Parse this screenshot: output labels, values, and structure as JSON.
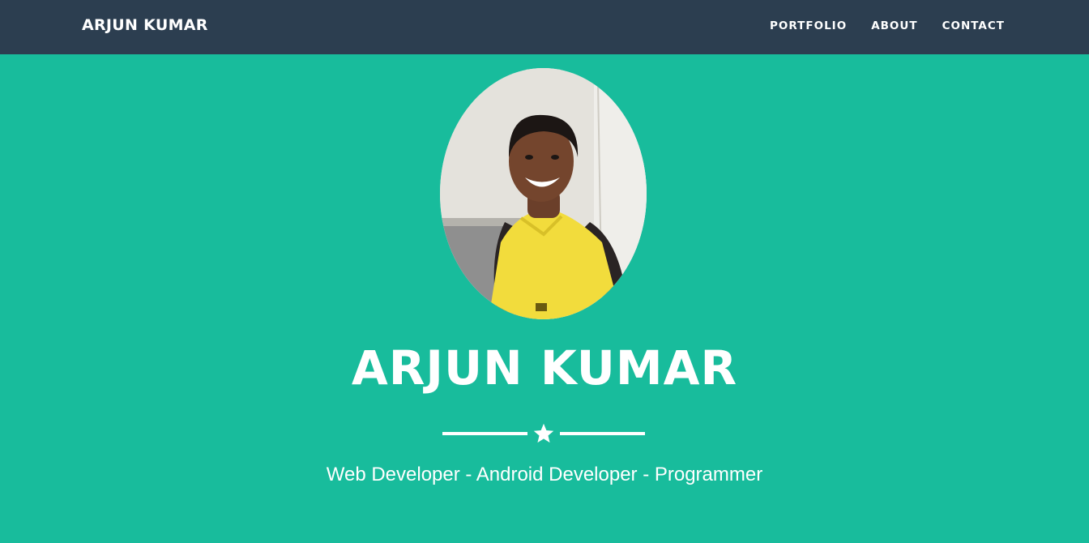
{
  "navbar": {
    "brand": "ARJUN KUMAR",
    "links": [
      "PORTFOLIO",
      "ABOUT",
      "CONTACT"
    ]
  },
  "hero": {
    "name": "ARJUN KUMAR",
    "divider_icon": "star-icon",
    "tagline": "Web Developer - Android Developer - Programmer"
  },
  "colors": {
    "navbar_bg": "#2c3e50",
    "hero_bg": "#18bc9c",
    "text": "#ffffff"
  }
}
